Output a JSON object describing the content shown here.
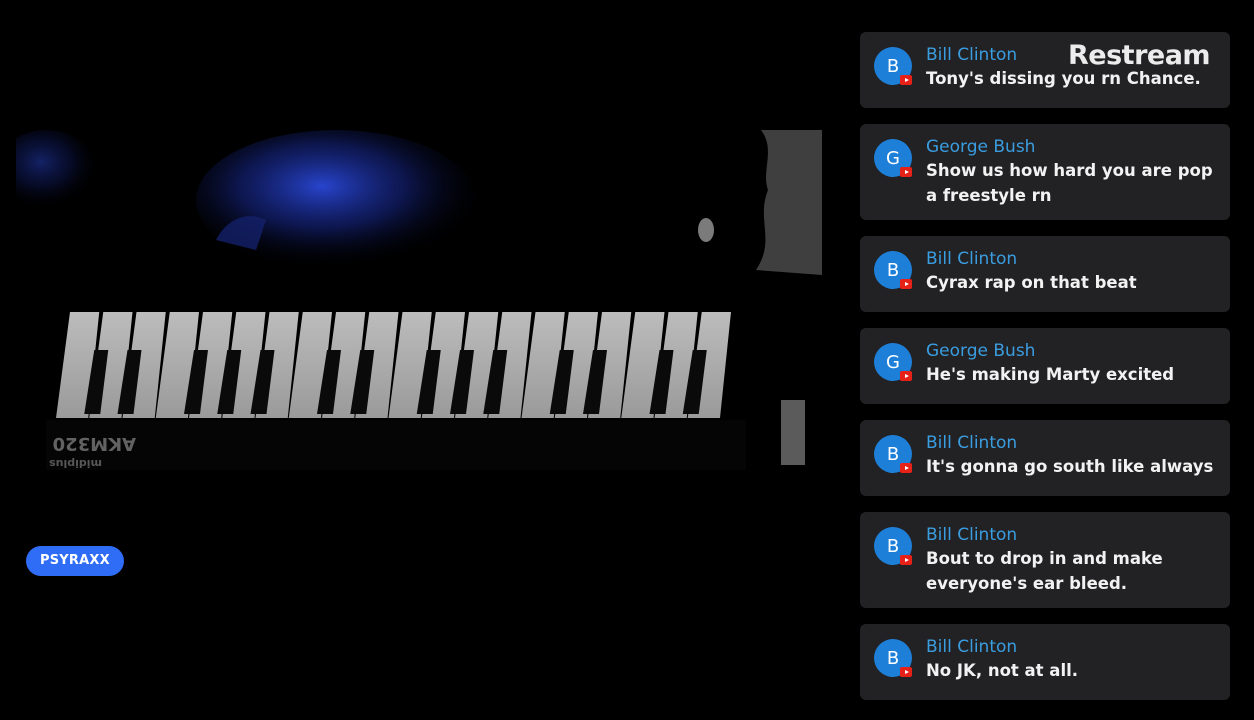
{
  "overlay": {
    "brand": "Restream",
    "streamer_name": "PSYRAXX",
    "keyboard_label": "AKM320",
    "keyboard_brand": "midiplus"
  },
  "chat": {
    "messages": [
      {
        "initial": "B",
        "author": "Bill Clinton",
        "text": "Tony's dissing you rn Chance.",
        "platform_icon": "youtube-icon"
      },
      {
        "initial": "G",
        "author": "George Bush",
        "text": "Show us how hard you are pop a freestyle rn",
        "platform_icon": "youtube-icon"
      },
      {
        "initial": "B",
        "author": "Bill Clinton",
        "text": "Cyrax rap on that beat",
        "platform_icon": "youtube-icon"
      },
      {
        "initial": "G",
        "author": "George Bush",
        "text": "He's making Marty excited",
        "platform_icon": "youtube-icon"
      },
      {
        "initial": "B",
        "author": "Bill Clinton",
        "text": "It's gonna go south like always",
        "platform_icon": "youtube-icon"
      },
      {
        "initial": "B",
        "author": "Bill Clinton",
        "text": "Bout to drop in and make everyone's ear bleed.",
        "platform_icon": "youtube-icon"
      },
      {
        "initial": "B",
        "author": "Bill Clinton",
        "text": "No JK, not at all.",
        "platform_icon": "youtube-icon"
      }
    ]
  },
  "colors": {
    "avatar": "#1e7fd8",
    "author": "#3a9de0",
    "badge": "#2f6df6",
    "card": "#222225",
    "youtube": "#e62117"
  }
}
